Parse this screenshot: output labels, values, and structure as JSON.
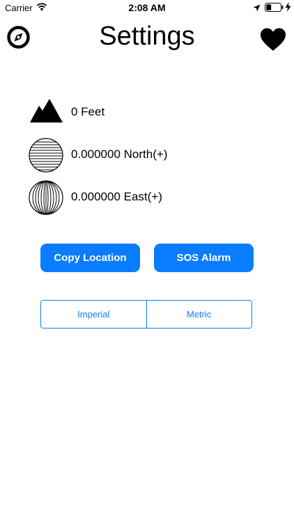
{
  "status_bar": {
    "carrier": "Carrier",
    "time": "2:08 AM",
    "icons": [
      "wifi-icon",
      "location-arrow-icon",
      "battery-icon",
      "charging-icon"
    ]
  },
  "nav": {
    "title": "Settings",
    "left_icon": "compass-icon",
    "right_icon": "heart-icon"
  },
  "info": {
    "altitude": "0 Feet",
    "latitude": "0.000000 North(+)",
    "longitude": "0.000000 East(+)",
    "icons": [
      "mountain-icon",
      "latitude-globe-icon",
      "longitude-globe-icon"
    ]
  },
  "actions": {
    "copy_location": "Copy Location",
    "sos_alarm": "SOS Alarm"
  },
  "units": {
    "options": [
      "Imperial",
      "Metric"
    ]
  },
  "colors": {
    "accent": "#0a7cff",
    "text": "#000000",
    "background": "#ffffff"
  }
}
